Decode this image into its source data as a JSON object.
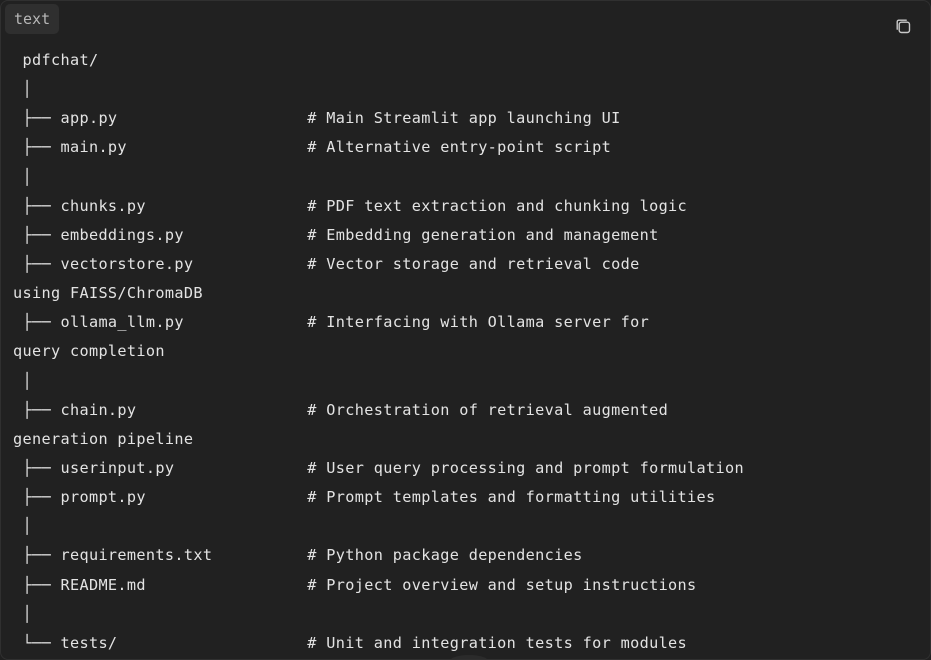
{
  "code_block": {
    "language_label": "text",
    "copy_icon": "copy-icon",
    "lines": [
      " pdfchat/",
      " │",
      " ├── app.py                    # Main Streamlit app launching UI",
      " ├── main.py                   # Alternative entry-point script",
      " │",
      " ├── chunks.py                 # PDF text extraction and chunking logic",
      " ├── embeddings.py             # Embedding generation and management",
      " ├── vectorstore.py            # Vector storage and retrieval code",
      "using FAISS/ChromaDB",
      " ├── ollama_llm.py             # Interfacing with Ollama server for",
      "query completion",
      " │",
      " ├── chain.py                  # Orchestration of retrieval augmented",
      "generation pipeline",
      " ├── userinput.py              # User query processing and prompt formulation",
      " ├── prompt.py                 # Prompt templates and formatting utilities",
      " │",
      " ├── requirements.txt          # Python package dependencies",
      " ├── README.md                 # Project overview and setup instructions",
      " │",
      " └── tests/                    # Unit and integration tests for modules"
    ]
  },
  "colors": {
    "background": "#212121",
    "text": "#e3e3e3",
    "tag_background": "#2f2f2f",
    "tag_text": "#b7b7b7"
  }
}
